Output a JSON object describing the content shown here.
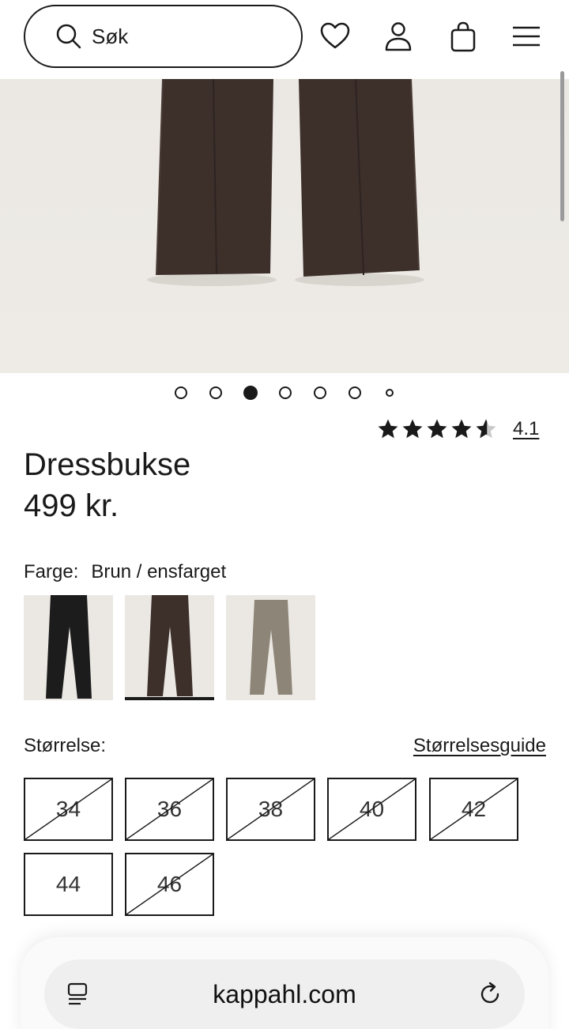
{
  "header": {
    "search_placeholder": "Søk",
    "icons": [
      "search-icon",
      "heart-icon",
      "user-icon",
      "bag-icon",
      "menu-icon"
    ]
  },
  "gallery": {
    "dot_count": 7,
    "active_index": 2
  },
  "product": {
    "title": "Dressbukse",
    "price": "499 kr.",
    "rating": {
      "value": 4.1,
      "display": "4.1",
      "max": 5
    },
    "color_label": "Farge:",
    "color_value": "Brun / ensfarget",
    "colors": [
      {
        "name": "black",
        "hex": "#1c1c1c",
        "selected": false
      },
      {
        "name": "brown",
        "hex": "#3d302b",
        "selected": true
      },
      {
        "name": "beige",
        "hex": "#8d8577",
        "selected": false
      }
    ],
    "size_label": "Størrelse:",
    "size_guide": "Størrelsesguide",
    "sizes": [
      {
        "label": "34",
        "available": false
      },
      {
        "label": "36",
        "available": false
      },
      {
        "label": "38",
        "available": false
      },
      {
        "label": "40",
        "available": false
      },
      {
        "label": "42",
        "available": false
      },
      {
        "label": "44",
        "available": true
      },
      {
        "label": "46",
        "available": false
      }
    ]
  },
  "browser": {
    "url": "kappahl.com"
  },
  "colors": {
    "text": "#1a1a1a",
    "hero_bg": "#ece9e4",
    "pants_brown": "#3d302b"
  }
}
